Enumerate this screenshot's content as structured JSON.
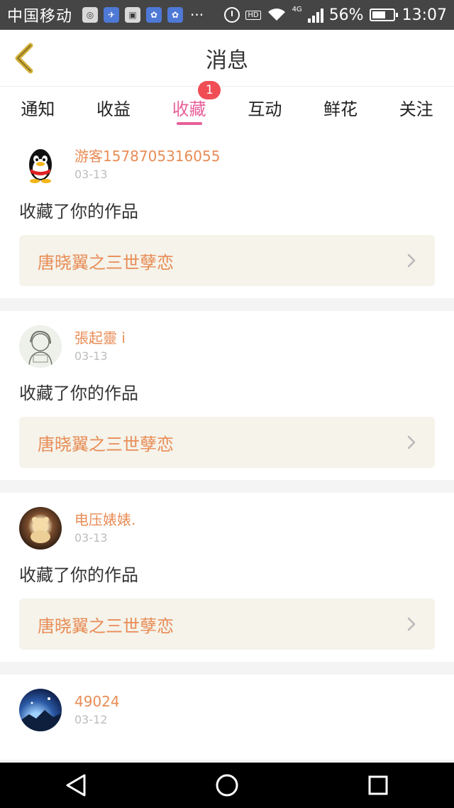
{
  "status_bar": {
    "carrier": "中国移动",
    "dots": "···",
    "hd": "HD",
    "network": "4G",
    "battery": "56%",
    "time": "13:07"
  },
  "header": {
    "title": "消息",
    "back_icon": "chevron-left-icon"
  },
  "tabs": [
    {
      "label": "通知"
    },
    {
      "label": "收益"
    },
    {
      "label": "收藏",
      "badge": "1"
    },
    {
      "label": "互动"
    },
    {
      "label": "鲜花"
    },
    {
      "label": "关注"
    }
  ],
  "active_tab_index": 2,
  "colors": {
    "accent": "#e8609a",
    "name": "#e88c56",
    "badge": "#f04d55"
  },
  "messages": [
    {
      "user": "游客1578705316055",
      "date": "03-13",
      "action": "收藏了你的作品",
      "work": "唐晓翼之三世孽恋"
    },
    {
      "user": "張起靈 i",
      "date": "03-13",
      "action": "收藏了你的作品",
      "work": "唐晓翼之三世孽恋"
    },
    {
      "user": "电压婊婊.",
      "date": "03-13",
      "action": "收藏了你的作品",
      "work": "唐晓翼之三世孽恋"
    },
    {
      "user": "49024",
      "date": "03-12"
    }
  ]
}
